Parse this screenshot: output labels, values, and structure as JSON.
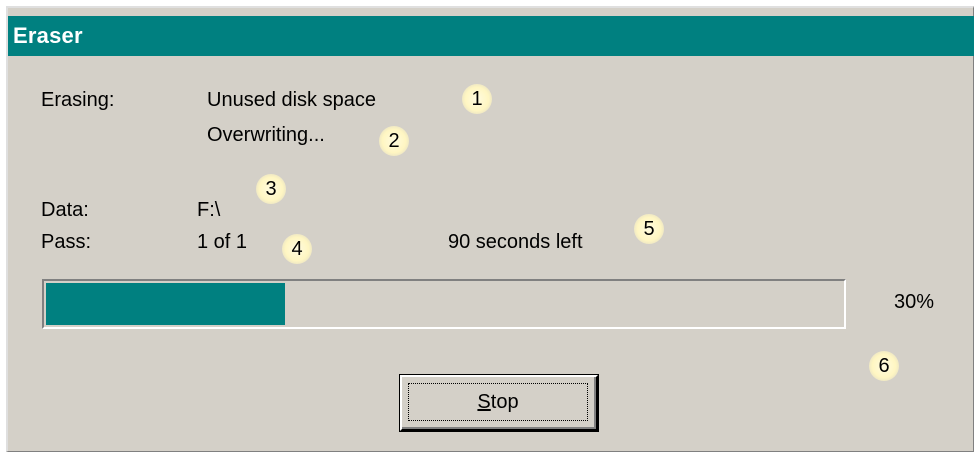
{
  "window": {
    "title": "Eraser"
  },
  "fields": {
    "erasing_label": "Erasing:",
    "erasing_value": "Unused disk space",
    "status": "Overwriting...",
    "data_label": "Data:",
    "data_value": "F:\\",
    "pass_label": "Pass:",
    "pass_value": "1 of 1",
    "time_left": "90 seconds left"
  },
  "progress": {
    "percent": 30,
    "percent_text": "30%",
    "fill_color": "#008080"
  },
  "buttons": {
    "stop_label": "Stop",
    "stop_mnemonic": "S",
    "stop_rest": "top"
  },
  "callouts": [
    "1",
    "2",
    "3",
    "4",
    "5",
    "6"
  ],
  "colors": {
    "title_bar": "#008080",
    "window_bg": "#d4d0c8",
    "callout_bg": "#fff6c2"
  }
}
